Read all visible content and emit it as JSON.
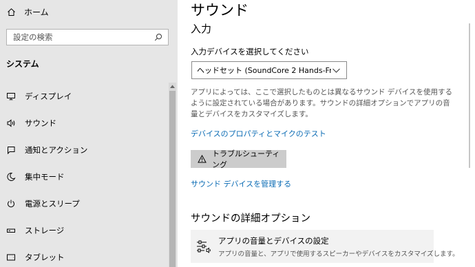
{
  "nav": {
    "home_label": "ホーム",
    "search_placeholder": "設定の検索",
    "section_label": "システム",
    "items": [
      {
        "label": "ディスプレイ",
        "icon": "monitor-icon"
      },
      {
        "label": "サウンド",
        "icon": "speaker-icon"
      },
      {
        "label": "通知とアクション",
        "icon": "notification-icon"
      },
      {
        "label": "集中モード",
        "icon": "moon-icon"
      },
      {
        "label": "電源とスリープ",
        "icon": "power-icon"
      },
      {
        "label": "ストレージ",
        "icon": "storage-icon"
      },
      {
        "label": "タブレット",
        "icon": "tablet-icon"
      }
    ]
  },
  "main": {
    "title": "サウンド",
    "subtitle": "入力",
    "select_label": "入力デバイスを選択してください",
    "select_value": "ヘッドセット (SoundCore 2 Hands-Fr...",
    "description": "アプリによっては、ここで選択したものとは異なるサウンド デバイスを使用するように設定されている場合があります。サウンドの詳細オプションでアプリの音量とデバイスをカスタマイズします。",
    "link_properties": "デバイスのプロパティとマイクのテスト",
    "troubleshoot_label": "トラブルシューティング",
    "link_manage": "サウンド デバイスを管理する",
    "advanced_heading": "サウンドの詳細オプション",
    "advanced_item_title": "アプリの音量とデバイスの設定",
    "advanced_item_desc": "アプリの音量と、アプリで使用するスピーカーやデバイスをカスタマイズします。"
  },
  "colors": {
    "nav_bg": "#e6e6e6",
    "link": "#0a6bb4",
    "button_bg": "#cccccc"
  }
}
